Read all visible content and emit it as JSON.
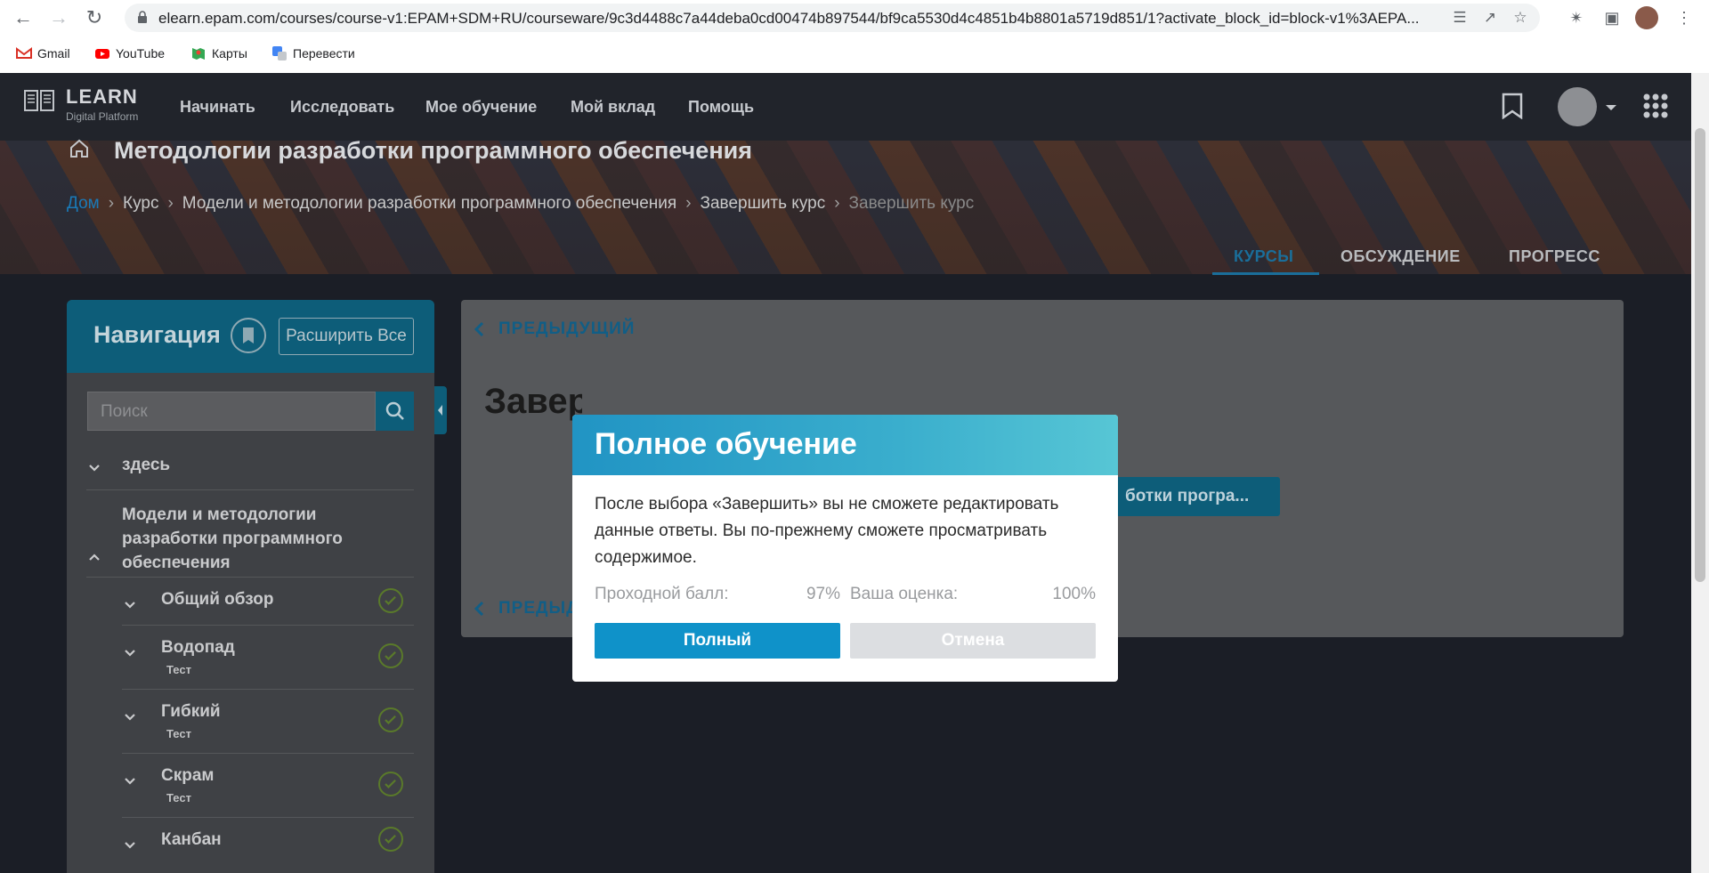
{
  "browser": {
    "url": "elearn.epam.com/courses/course-v1:EPAM+SDM+RU/courseware/9c3d4488c7a44deba0cd00474b897544/bf9ca5530d4c4851b4b8801a5719d851/1?activate_block_id=block-v1%3AEPA...",
    "bookmarks": [
      "Gmail",
      "YouTube",
      "Карты",
      "Перевести"
    ]
  },
  "site": {
    "logo_title": "LEARN",
    "logo_subtitle": "Digital Platform",
    "menu": [
      "Начинать",
      "Исследовать",
      "Мое обучение",
      "Мой вклад",
      "Помощь"
    ]
  },
  "course": {
    "title": "Методологии разработки программного обеспечения",
    "breadcrumb": {
      "home": "Дом",
      "items": [
        "Курс",
        "Модели и методологии разработки программного обеспечения",
        "Завершить курс"
      ],
      "current": "Завершить курс"
    },
    "tabs": [
      "КУРСЫ",
      "ОБСУЖДЕНИЕ",
      "ПРОГРЕСС"
    ]
  },
  "nav": {
    "title": "Навигация",
    "expand_all": "Расширить Все",
    "search_placeholder": "Поиск",
    "sections": [
      {
        "title": "здесь"
      },
      {
        "title": "Модели и методологии разработки программного обеспечения"
      }
    ],
    "subsections": [
      {
        "title": "Общий обзор",
        "type": ""
      },
      {
        "title": "Водопад",
        "type": "Тест"
      },
      {
        "title": "Гибкий",
        "type": "Тест"
      },
      {
        "title": "Скрам",
        "type": "Тест"
      },
      {
        "title": "Канбан",
        "type": ""
      }
    ]
  },
  "main": {
    "prev_label": "ПРЕДЫДУЩИЙ",
    "heading": "Завер",
    "button_label": "ботки програ...",
    "prev_bottom_label": "ПРЕДЫДУ"
  },
  "modal": {
    "title": "Полное обучение",
    "text": "После выбора «Завершить» вы не сможете редактировать данные ответы. Вы по-прежнему сможете просматривать содержимое.",
    "passing_label": "Проходной балл:",
    "passing_value": "97%",
    "grade_label": "Ваша оценка:",
    "grade_value": "100%",
    "confirm": "Полный",
    "cancel": "Отмена"
  },
  "colors": {
    "accent": "#0f92c9",
    "nav_header": "#0d5d79",
    "check": "#5a7a2a"
  }
}
